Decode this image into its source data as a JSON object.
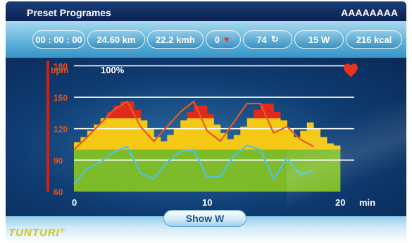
{
  "header": {
    "title": "Preset Programes",
    "user": "AAAAAAAA"
  },
  "stats": [
    {
      "name": "time",
      "value": "00 : 00 : 00"
    },
    {
      "name": "distance",
      "value": "24.60 km"
    },
    {
      "name": "speed",
      "value": "22.2 kmh"
    },
    {
      "name": "heart-rate",
      "value": "0",
      "icon": "heart-icon"
    },
    {
      "name": "cadence",
      "value": "74",
      "icon": "loop-arrow-icon"
    },
    {
      "name": "power",
      "value": "15  W"
    },
    {
      "name": "energy",
      "value": "216 kcal"
    }
  ],
  "chart": {
    "unit_label": "bpm",
    "percent_label": "100%",
    "x_unit": "min"
  },
  "chart_data": {
    "type": "area",
    "ylabel": "bpm",
    "xlabel": "min",
    "ylim": [
      60,
      185
    ],
    "xlim": [
      0,
      20
    ],
    "y_ticks": [
      60,
      90,
      120,
      150,
      180
    ],
    "x_ticks": [
      0,
      10,
      20
    ],
    "zones": [
      {
        "name": "green",
        "color": "#7dbb2a",
        "from": 60,
        "to": 100
      },
      {
        "name": "yellow",
        "color": "#f4c815",
        "from": 100,
        "to": 130
      },
      {
        "name": "red",
        "color": "#e12a1e",
        "from": 130,
        "to": 150
      }
    ],
    "profile_x": [
      0,
      0.5,
      1,
      1.5,
      2,
      2.5,
      3,
      3.5,
      4,
      4.5,
      5,
      5.5,
      6,
      6.5,
      7,
      7.5,
      8,
      8.5,
      9,
      9.5,
      10,
      10.5,
      11,
      11.5,
      12,
      12.5,
      13,
      13.5,
      14,
      14.5,
      15,
      15.5,
      16,
      16.5,
      17,
      17.5,
      18,
      18.5,
      19,
      19.5,
      20
    ],
    "profile_y": [
      107,
      112,
      118,
      124,
      130,
      136,
      142,
      146,
      146,
      138,
      128,
      120,
      112,
      108,
      114,
      120,
      128,
      136,
      142,
      142,
      134,
      124,
      116,
      110,
      114,
      122,
      130,
      138,
      144,
      144,
      136,
      128,
      120,
      112,
      118,
      126,
      120,
      112,
      106,
      104,
      100
    ],
    "series": [
      {
        "color": "#e85a1e",
        "x": [
          0,
          1,
          2,
          3,
          4,
          5,
          6,
          7,
          8,
          9,
          10,
          11,
          12,
          13,
          14,
          15,
          16,
          17,
          18
        ],
        "values": [
          100,
          112,
          125,
          138,
          146,
          122,
          108,
          122,
          136,
          146,
          118,
          108,
          126,
          144,
          144,
          116,
          122,
          110,
          103
        ]
      },
      {
        "color": "#4fc3e8",
        "x": [
          0,
          1,
          2,
          3,
          4,
          5,
          6,
          7,
          8,
          9,
          10,
          11,
          12,
          13,
          14,
          15,
          16,
          17,
          18
        ],
        "values": [
          67,
          82,
          88,
          98,
          103,
          78,
          72,
          88,
          98,
          100,
          74,
          74,
          94,
          104,
          100,
          72,
          92,
          76,
          80
        ]
      }
    ]
  }
}
